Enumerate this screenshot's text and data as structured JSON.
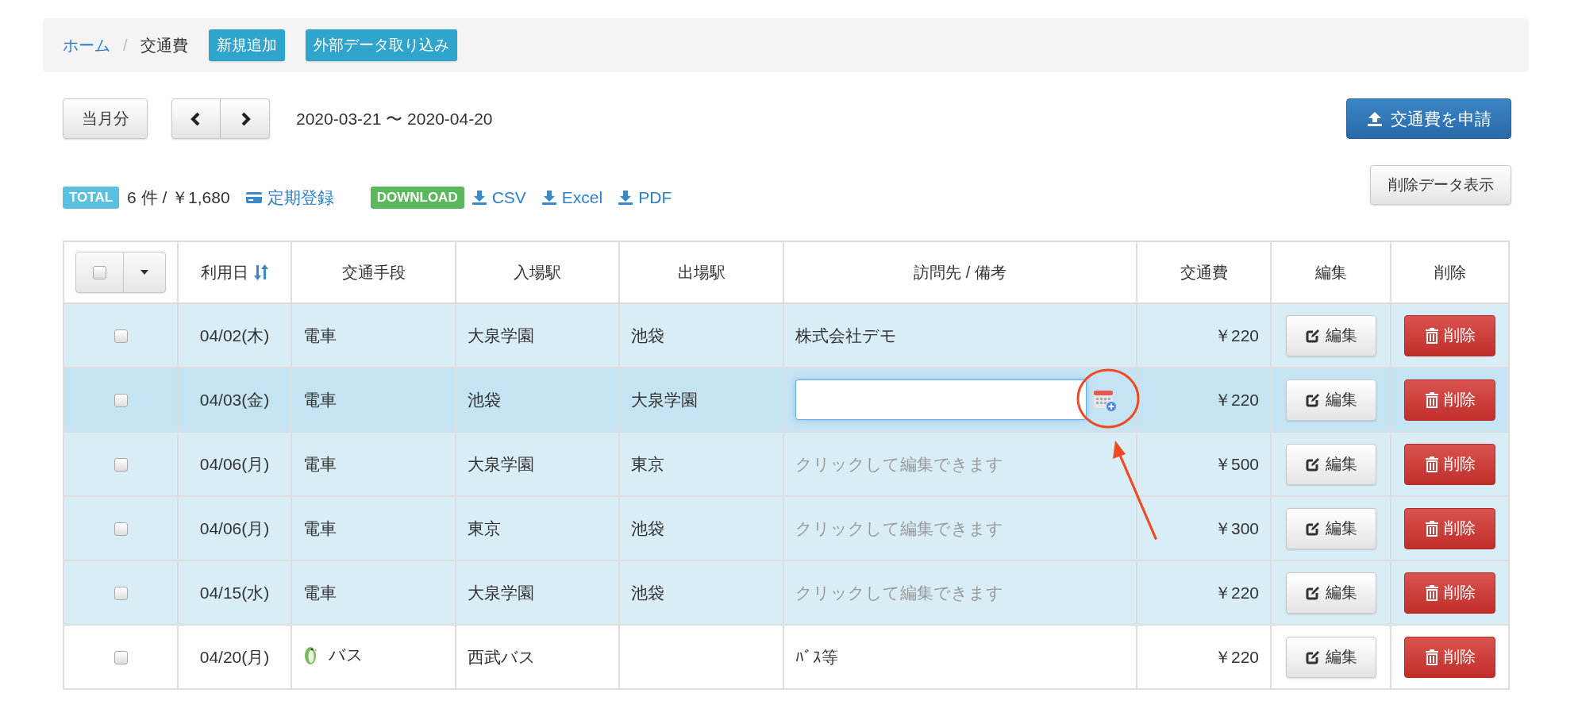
{
  "breadcrumb": {
    "items": [
      {
        "label": "ホーム",
        "link": true
      },
      {
        "label": "交通費",
        "link": false
      }
    ],
    "separator": "/",
    "buttons": [
      "新規追加",
      "外部データ取り込み"
    ]
  },
  "toolbar": {
    "current_month_button": "当月分",
    "period": "2020-03-21 〜 2020-04-20",
    "apply_button": "交通費を申請",
    "deleted_button": "削除データ表示"
  },
  "summary": {
    "total_badge": "TOTAL",
    "total_text": "6 件 / ￥1,680",
    "commuter_link": "定期登録",
    "download_badge": "DOWNLOAD",
    "downloads": [
      "CSV",
      "Excel",
      "PDF"
    ]
  },
  "table": {
    "header_checkbox": {
      "checked": false
    },
    "columns": [
      {
        "label": "利用日",
        "sortable": true
      },
      {
        "label": "交通手段",
        "sortable": false
      },
      {
        "label": "入場駅",
        "sortable": false
      },
      {
        "label": "出場駅",
        "sortable": false
      },
      {
        "label": "訪問先 / 備考",
        "sortable": false
      },
      {
        "label": "交通費",
        "sortable": false
      },
      {
        "label": "編集",
        "sortable": false
      },
      {
        "label": "削除",
        "sortable": false
      }
    ],
    "rows": [
      {
        "checked": false,
        "highlighted": true,
        "active": false,
        "date": "04/02(木)",
        "transport": "電車",
        "bus_icon": false,
        "entry": "大泉学園",
        "exit": "池袋",
        "note": {
          "kind": "text",
          "text": "株式会社デモ"
        },
        "fare": "￥220",
        "edit": "編集",
        "delete": "削除"
      },
      {
        "checked": false,
        "highlighted": true,
        "active": true,
        "date": "04/03(金)",
        "transport": "電車",
        "bus_icon": false,
        "entry": "池袋",
        "exit": "大泉学園",
        "note": {
          "kind": "input"
        },
        "fare": "￥220",
        "edit": "編集",
        "delete": "削除"
      },
      {
        "checked": false,
        "highlighted": true,
        "active": false,
        "date": "04/06(月)",
        "transport": "電車",
        "bus_icon": false,
        "entry": "大泉学園",
        "exit": "東京",
        "note": {
          "kind": "placeholder",
          "text": "クリックして編集できます"
        },
        "fare": "￥500",
        "edit": "編集",
        "delete": "削除"
      },
      {
        "checked": false,
        "highlighted": true,
        "active": false,
        "date": "04/06(月)",
        "transport": "電車",
        "bus_icon": false,
        "entry": "東京",
        "exit": "池袋",
        "note": {
          "kind": "placeholder",
          "text": "クリックして編集できます"
        },
        "fare": "￥300",
        "edit": "編集",
        "delete": "削除"
      },
      {
        "checked": false,
        "highlighted": true,
        "active": false,
        "date": "04/15(水)",
        "transport": "電車",
        "bus_icon": false,
        "entry": "大泉学園",
        "exit": "池袋",
        "note": {
          "kind": "placeholder",
          "text": "クリックして編集できます"
        },
        "fare": "￥220",
        "edit": "編集",
        "delete": "削除"
      },
      {
        "checked": false,
        "highlighted": false,
        "active": false,
        "date": "04/20(月)",
        "transport": "バス",
        "bus_icon": true,
        "entry": "西武バス",
        "exit": "",
        "note": {
          "kind": "text",
          "text": "ﾊﾞｽ等"
        },
        "fare": "￥220",
        "edit": "編集",
        "delete": "削除"
      }
    ]
  }
}
